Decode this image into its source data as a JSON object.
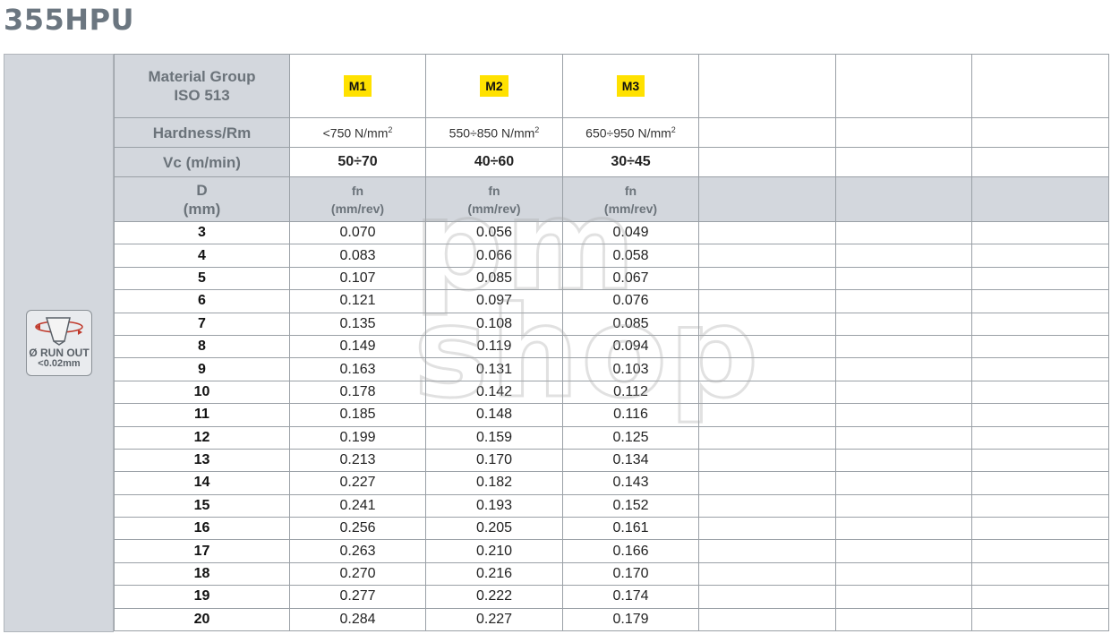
{
  "title": "355HPU",
  "runout": {
    "line1": "Ø RUN OUT",
    "line2": "<0.02mm",
    "icon": "drill-runout-icon"
  },
  "header": {
    "material_group_line1": "Material Group",
    "material_group_line2": "ISO 513",
    "hardness_label": "Hardness/Rm",
    "vc_label": "Vc (m/min)",
    "d_label_line1": "D",
    "d_label_line2": "(mm)"
  },
  "groups": [
    {
      "badge": "M1",
      "hardness": "<750 N/mm",
      "vc": "50÷70",
      "fn": "fn",
      "fn_unit": "(mm/rev)"
    },
    {
      "badge": "M2",
      "hardness": "550÷850 N/mm",
      "vc": "40÷60",
      "fn": "fn",
      "fn_unit": "(mm/rev)"
    },
    {
      "badge": "M3",
      "hardness": "650÷950 N/mm",
      "vc": "30÷45",
      "fn": "fn",
      "fn_unit": "(mm/rev)"
    }
  ],
  "hardness_exponent": "2",
  "badge_color": "#ffe100",
  "watermark": {
    "line1": "pm",
    "line2": "shop"
  },
  "rows": [
    {
      "d": "3",
      "m1": "0.070",
      "m2": "0.056",
      "m3": "0.049"
    },
    {
      "d": "4",
      "m1": "0.083",
      "m2": "0.066",
      "m3": "0.058"
    },
    {
      "d": "5",
      "m1": "0.107",
      "m2": "0.085",
      "m3": "0.067"
    },
    {
      "d": "6",
      "m1": "0.121",
      "m2": "0.097",
      "m3": "0.076"
    },
    {
      "d": "7",
      "m1": "0.135",
      "m2": "0.108",
      "m3": "0.085"
    },
    {
      "d": "8",
      "m1": "0.149",
      "m2": "0.119",
      "m3": "0.094"
    },
    {
      "d": "9",
      "m1": "0.163",
      "m2": "0.131",
      "m3": "0.103"
    },
    {
      "d": "10",
      "m1": "0.178",
      "m2": "0.142",
      "m3": "0.112"
    },
    {
      "d": "11",
      "m1": "0.185",
      "m2": "0.148",
      "m3": "0.116"
    },
    {
      "d": "12",
      "m1": "0.199",
      "m2": "0.159",
      "m3": "0.125"
    },
    {
      "d": "13",
      "m1": "0.213",
      "m2": "0.170",
      "m3": "0.134"
    },
    {
      "d": "14",
      "m1": "0.227",
      "m2": "0.182",
      "m3": "0.143"
    },
    {
      "d": "15",
      "m1": "0.241",
      "m2": "0.193",
      "m3": "0.152"
    },
    {
      "d": "16",
      "m1": "0.256",
      "m2": "0.205",
      "m3": "0.161"
    },
    {
      "d": "17",
      "m1": "0.263",
      "m2": "0.210",
      "m3": "0.166"
    },
    {
      "d": "18",
      "m1": "0.270",
      "m2": "0.216",
      "m3": "0.170"
    },
    {
      "d": "19",
      "m1": "0.277",
      "m2": "0.222",
      "m3": "0.174"
    },
    {
      "d": "20",
      "m1": "0.284",
      "m2": "0.227",
      "m3": "0.179"
    }
  ]
}
